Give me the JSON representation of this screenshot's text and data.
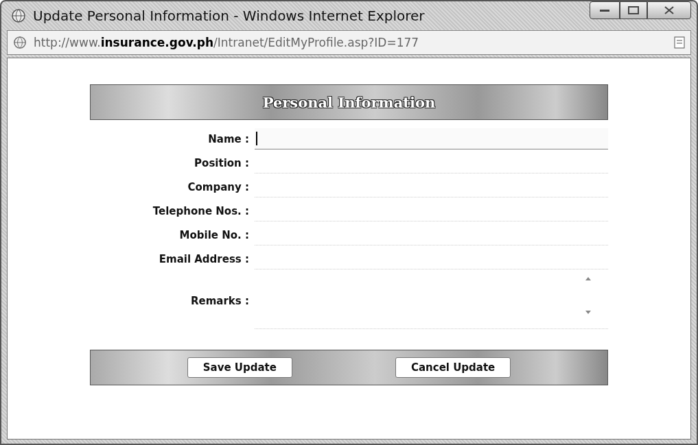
{
  "window": {
    "title": "Update Personal Information - Windows Internet Explorer"
  },
  "address_bar": {
    "url": "http://www.**insurance.gov.ph**/Intranet/EditMyProfile.asp?ID=177"
  },
  "form": {
    "heading": "Personal Information",
    "fields": [
      {
        "label": "Name",
        "separator": ":",
        "kind": "text",
        "focused": true
      },
      {
        "label": "Position",
        "separator": ":",
        "kind": "text",
        "focused": false
      },
      {
        "label": "Company",
        "separator": ":",
        "kind": "text",
        "focused": false
      },
      {
        "label": "Telephone Nos.",
        "separator": ":",
        "kind": "text",
        "focused": false
      },
      {
        "label": "Mobile No.",
        "separator": ":",
        "kind": "text",
        "focused": false
      },
      {
        "label": "Email Address",
        "separator": ":",
        "kind": "text",
        "focused": false
      },
      {
        "label": "Remarks",
        "separator": ":",
        "kind": "textarea",
        "focused": false
      }
    ],
    "buttons": [
      "Save Update",
      "Cancel Update"
    ]
  }
}
